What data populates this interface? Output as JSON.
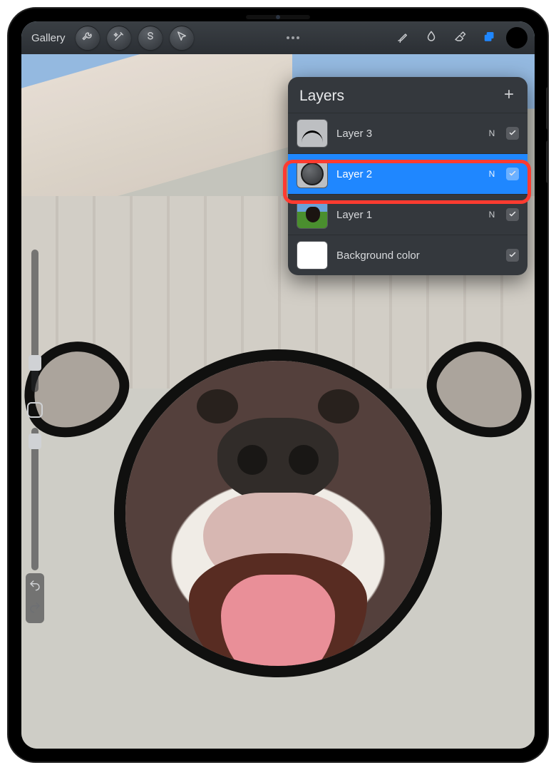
{
  "toolbar": {
    "gallery_label": "Gallery"
  },
  "layers_panel": {
    "title": "Layers",
    "items": [
      {
        "name": "Layer 3",
        "blend": "N",
        "visible": true,
        "selected": false,
        "thumb": "l3"
      },
      {
        "name": "Layer 2",
        "blend": "N",
        "visible": true,
        "selected": true,
        "thumb": "l2"
      },
      {
        "name": "Layer 1",
        "blend": "N",
        "visible": true,
        "selected": false,
        "thumb": "l1"
      },
      {
        "name": "Background color",
        "blend": "",
        "visible": true,
        "selected": false,
        "thumb": "bg"
      }
    ]
  },
  "colors": {
    "accent": "#1f87ff",
    "highlight": "#ff3b30",
    "swatch": "#000000"
  }
}
